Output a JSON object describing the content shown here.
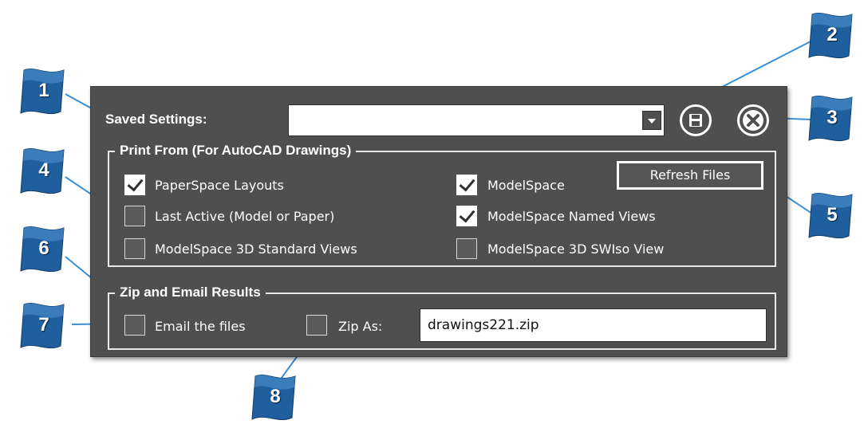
{
  "dialog": {
    "saved_settings_label": "Saved Settings:",
    "saved_settings_value": "",
    "save_icon": "floppy-disk-icon",
    "close_icon": "close-x-icon"
  },
  "print_from": {
    "title": "Print From (For AutoCAD Drawings)",
    "options": [
      {
        "label": "PaperSpace Layouts",
        "checked": true
      },
      {
        "label": "ModelSpace",
        "checked": true
      },
      {
        "label": "Last Active (Model or Paper)",
        "checked": false
      },
      {
        "label": "ModelSpace Named Views",
        "checked": true
      },
      {
        "label": "ModelSpace 3D Standard Views",
        "checked": false
      },
      {
        "label": "ModelSpace 3D SWIso View",
        "checked": false
      }
    ],
    "refresh_label": "Refresh Files"
  },
  "zip_email": {
    "title": "Zip and Email Results",
    "email_label": "Email the files",
    "email_checked": false,
    "zip_label": "Zip As:",
    "zip_checked": false,
    "zip_filename": "drawings221.zip"
  },
  "callouts": [
    "1",
    "2",
    "3",
    "4",
    "5",
    "6",
    "7",
    "8"
  ],
  "colors": {
    "dialog_bg": "#4f4f4f",
    "callout_blue": "#1f5f9e",
    "leader_blue": "#3a8fd6",
    "marker_red": "#d0102a"
  }
}
